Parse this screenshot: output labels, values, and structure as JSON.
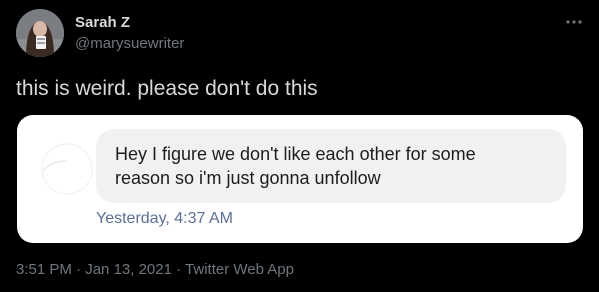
{
  "author": {
    "display_name": "Sarah Z",
    "handle": "@marysuewriter"
  },
  "tweet": {
    "text": "this is weird. please don't do this"
  },
  "screenshot": {
    "message": "Hey I figure we don't like each other for some\nreason so i'm just gonna unfollow",
    "timestamp": "Yesterday, 4:37 AM"
  },
  "meta": {
    "time": "3:51 PM",
    "sep1": " · ",
    "date": "Jan 13, 2021",
    "sep2": " · ",
    "source": "Twitter Web App"
  },
  "icons": {
    "more": "more-horizontal-icon",
    "avatar": "profile-photo"
  },
  "colors": {
    "background": "#000000",
    "primary_text": "#d9d9d9",
    "secondary_text": "#6e767d",
    "bubble": "#f1f1f1",
    "message_time": "#5b6f99"
  }
}
